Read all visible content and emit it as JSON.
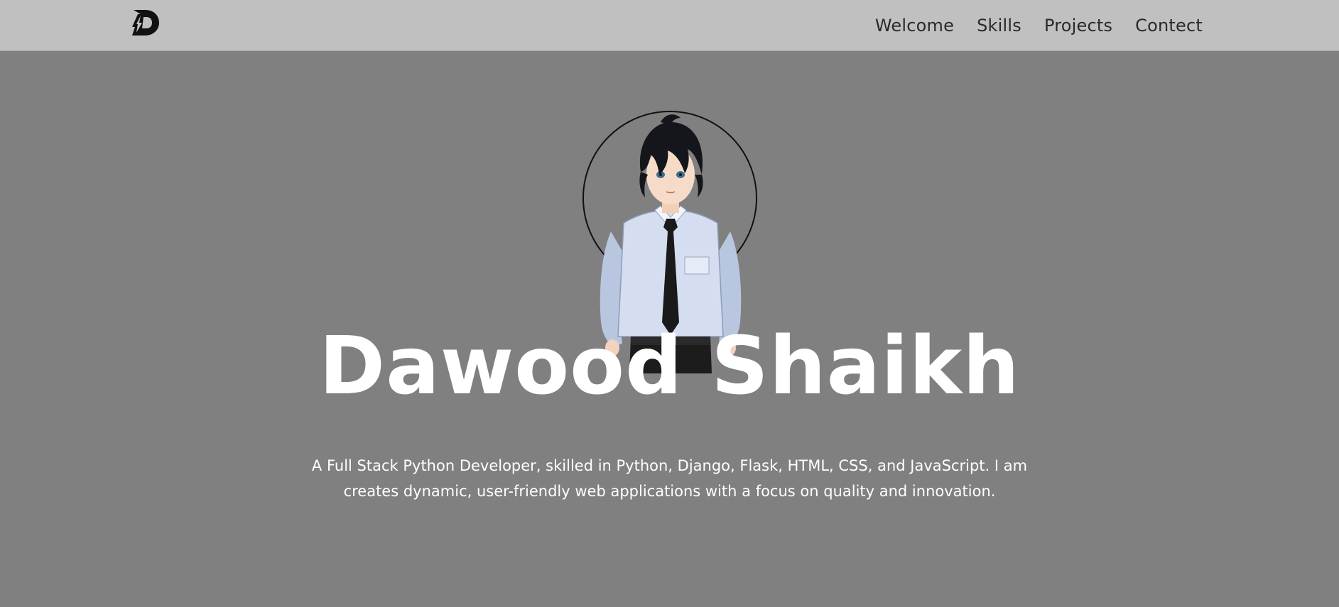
{
  "nav": {
    "logo_icon": "lightning-d-logo-icon",
    "links": [
      {
        "label": "Welcome"
      },
      {
        "label": "Skills"
      },
      {
        "label": "Projects"
      },
      {
        "label": "Contect"
      }
    ]
  },
  "hero": {
    "avatar_icon": "anime-character-avatar",
    "name": "Dawood Shaikh",
    "description": "A Full Stack Python Developer, skilled in Python, Django, Flask, HTML, CSS, and JavaScript. I am creates dynamic, user-friendly web applications with a focus on quality and innovation."
  },
  "colors": {
    "navbar_bg": "#c0c0c0",
    "page_bg": "#808080",
    "text_light": "#ffffff",
    "text_dark": "#2a2a2a"
  }
}
